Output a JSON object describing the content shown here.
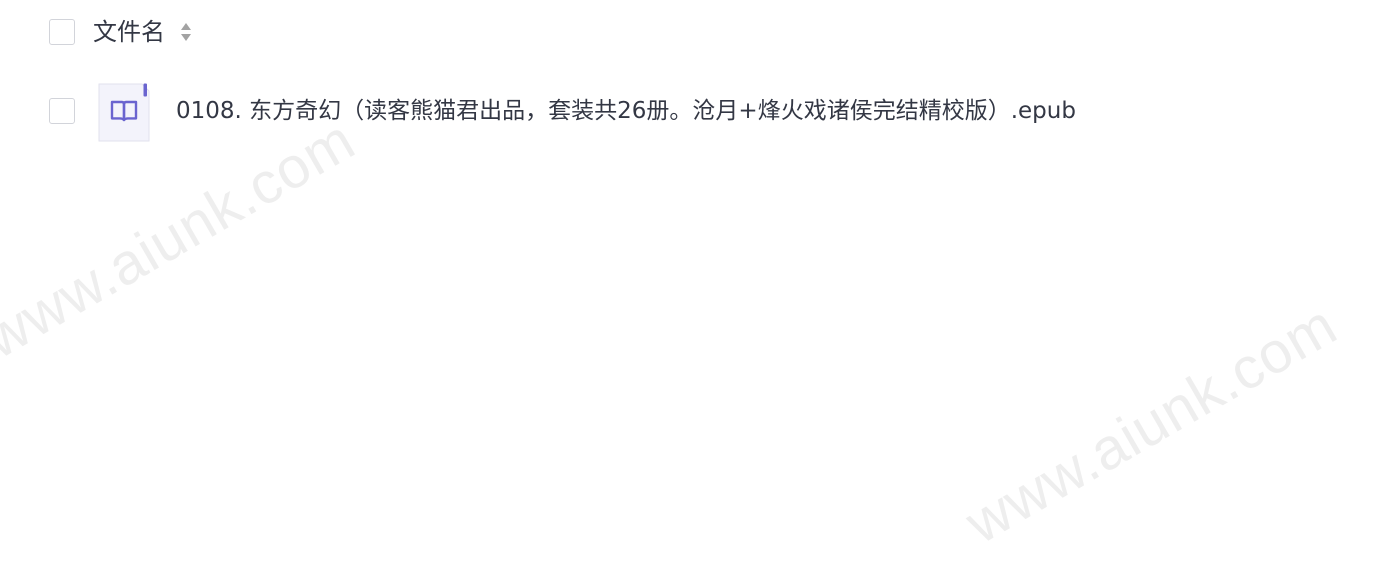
{
  "file_list": {
    "header": {
      "column_label": "文件名",
      "sort_icon": "sort-updown-icon"
    },
    "rows": [
      {
        "name": "0108. 东方奇幻（读客熊猫君出品，套装共26册。沧月+烽火戏诸侯完结精校版）.epub",
        "icon": "book-icon",
        "selected": false
      }
    ]
  },
  "watermarks": [
    "www.aiunk.com",
    "www.aiunk.com"
  ],
  "colors": {
    "text": "#333744",
    "checkbox_border": "#d2d4da",
    "file_icon_bg": "#f3f3fb",
    "file_icon_accent": "#6a64cf",
    "sort_icon": "#a3a3a3"
  }
}
